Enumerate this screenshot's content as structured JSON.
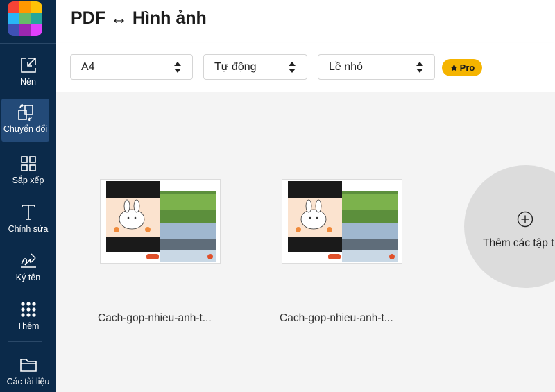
{
  "app": {
    "title": "PDF ↔ Hình ảnh"
  },
  "sidebar": {
    "items": [
      {
        "label": "Nén",
        "icon": "compress-icon"
      },
      {
        "label": "Chuyển đổi",
        "icon": "convert-icon",
        "active": true
      },
      {
        "label": "Sắp xếp",
        "icon": "grid-icon"
      },
      {
        "label": "Chỉnh sửa",
        "icon": "text-edit-icon"
      },
      {
        "label": "Ký tên",
        "icon": "signature-icon"
      },
      {
        "label": "Thêm",
        "icon": "more-dots-icon"
      },
      {
        "label": "Các tài liệu",
        "icon": "folder-icon"
      }
    ]
  },
  "toolbar": {
    "page_size": "A4",
    "orientation": "Tự động",
    "margin": "Lề nhỏ",
    "pro_badge": "Pro"
  },
  "files": [
    {
      "name": "Cach-gop-nhieu-anh-t..."
    },
    {
      "name": "Cach-gop-nhieu-anh-t..."
    }
  ],
  "add_files": {
    "label": "Thêm các tập t"
  },
  "colors": {
    "sidebar_bg": "#0b2a4a",
    "sidebar_active": "#234a78",
    "pro_badge": "#f5b400",
    "logo": [
      "#f44336",
      "#ff9800",
      "#ffc107",
      "#29b6f6",
      "#66bb6a",
      "#26a69a",
      "#3f51b5",
      "#9c27b0",
      "#e040fb"
    ]
  }
}
